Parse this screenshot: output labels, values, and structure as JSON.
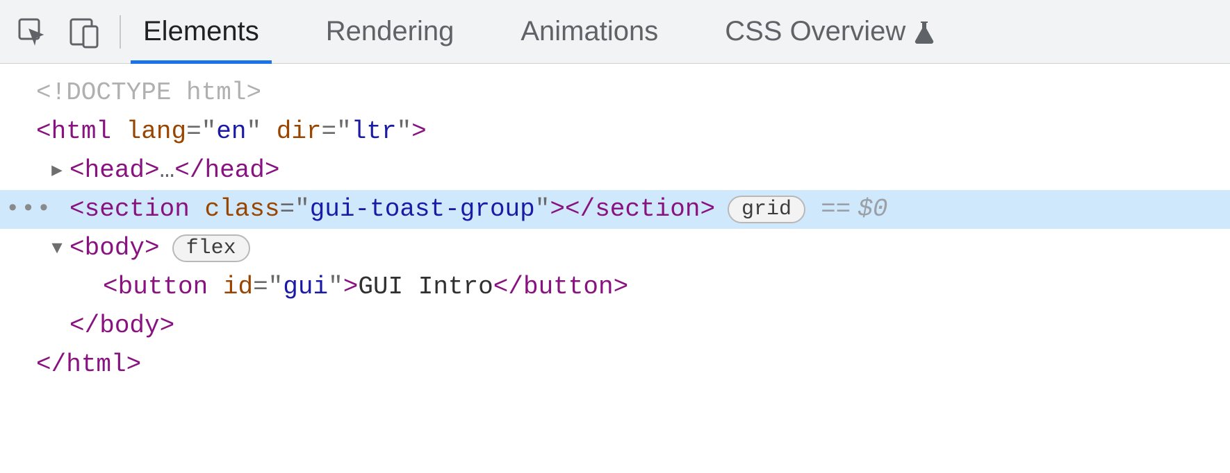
{
  "toolbar": {
    "tabs": {
      "elements": "Elements",
      "rendering": "Rendering",
      "animations": "Animations",
      "css_overview": "CSS Overview"
    }
  },
  "tree": {
    "doctype": "<!DOCTYPE html>",
    "html_open": {
      "tag": "html",
      "attrs": [
        {
          "name": "lang",
          "value": "en"
        },
        {
          "name": "dir",
          "value": "ltr"
        }
      ]
    },
    "head": {
      "tag": "head",
      "ellipsis": "…"
    },
    "section": {
      "tag": "section",
      "attrs": [
        {
          "name": "class",
          "value": "gui-toast-group"
        }
      ],
      "display_pill": "grid",
      "selected_ref": "$0"
    },
    "body": {
      "tag": "body",
      "display_pill": "flex"
    },
    "button": {
      "tag": "button",
      "attrs": [
        {
          "name": "id",
          "value": "gui"
        }
      ],
      "text": " GUI Intro "
    },
    "gutter_dots": "•••",
    "eqeq": "=="
  }
}
